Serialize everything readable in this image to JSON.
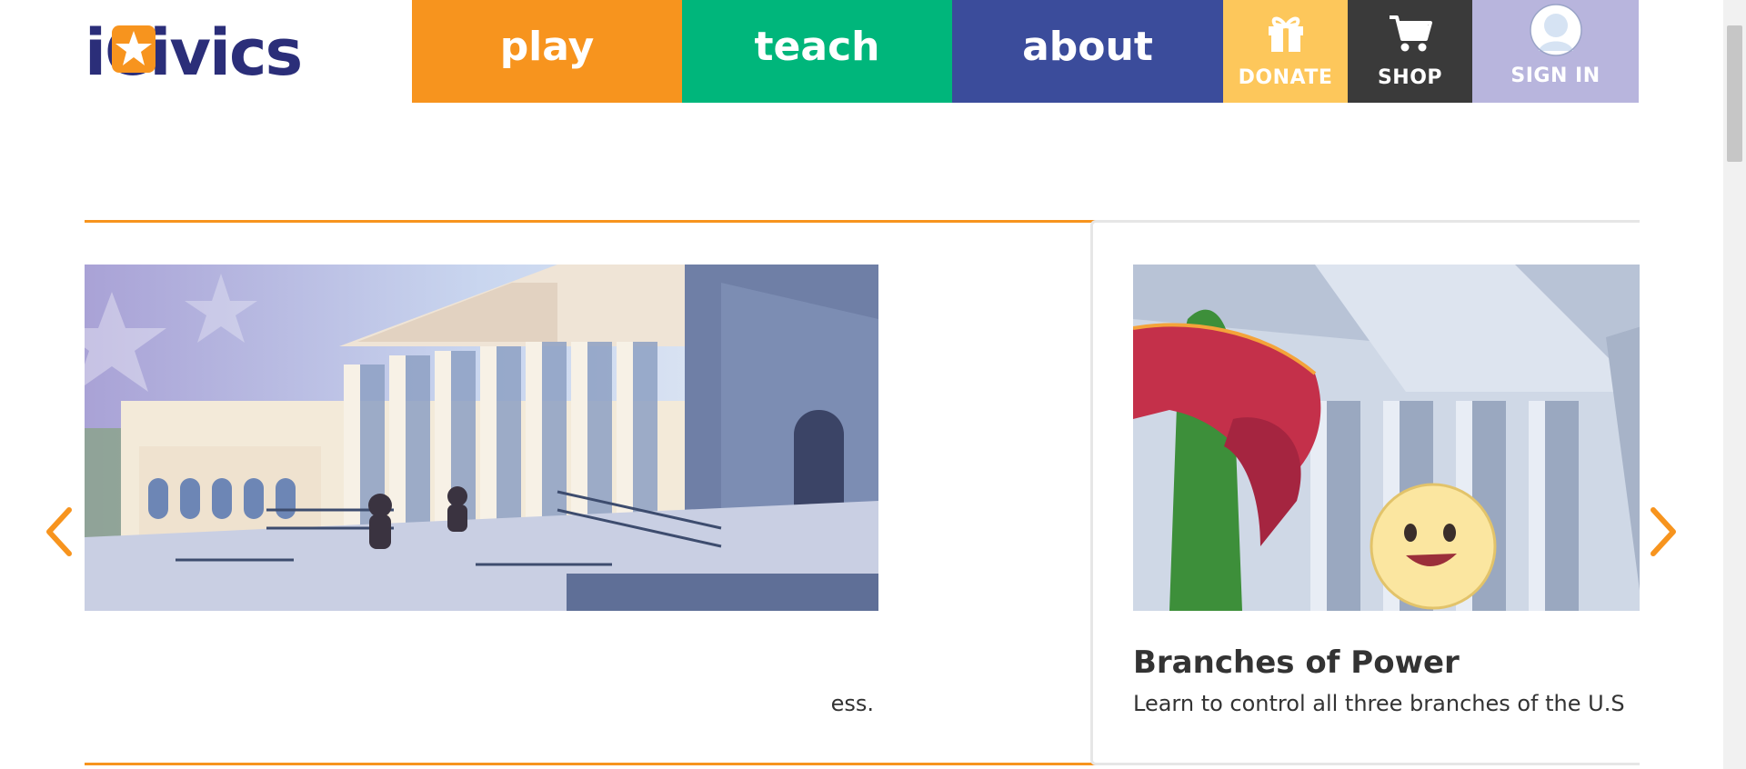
{
  "header": {
    "logo_text": "iCivics",
    "nav": {
      "play": "play",
      "teach": "teach",
      "about": "about"
    },
    "utility": {
      "donate": "DONATE",
      "shop": "SHOP",
      "sign_in": "SIGN IN"
    }
  },
  "carousel": {
    "active_card": {
      "title": "",
      "description": "ess."
    },
    "next_card": {
      "title": "Branches of Power",
      "description": "Learn to control all three branches of the U.S"
    }
  },
  "icons": {
    "donate": "gift-icon",
    "shop": "cart-icon",
    "sign_in": "user-avatar-icon",
    "prev": "chevron-left-icon",
    "next": "chevron-right-icon"
  },
  "colors": {
    "play": "#f7941e",
    "teach": "#00b67b",
    "about": "#3b4c9b",
    "donate": "#fdc75b",
    "shop": "#3a3a3a",
    "sign_in": "#b8b5dd",
    "logo": "#2b2e79",
    "accent": "#f7941e"
  }
}
